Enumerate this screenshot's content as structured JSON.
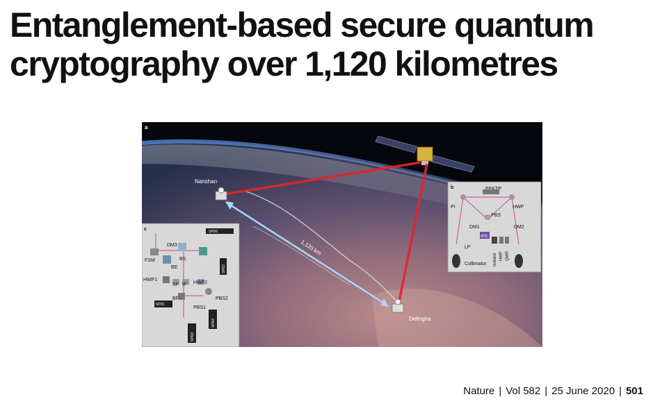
{
  "article": {
    "title_line1": "Entanglement-based secure quantum",
    "title_line2": "cryptography over 1,120 kilometres"
  },
  "figure": {
    "panel_a": {
      "label": "a",
      "ground_station_1": "Nanshan",
      "ground_station_2": "Delingha",
      "distance": "1,120 km"
    },
    "panel_b": {
      "label": "b",
      "components": [
        "PPKTP",
        "PI",
        "HWP",
        "PBS",
        "DM1",
        "DM2",
        "405",
        "LP",
        "Isolator",
        "HWP",
        "QWP",
        "Collimator"
      ]
    },
    "panel_c": {
      "label": "c",
      "components": [
        "DM3",
        "FSM",
        "BS",
        "BE",
        "HWP1",
        "SF",
        "IF",
        "HWP2",
        "PBS2",
        "BF",
        "SPD1",
        "PBS1"
      ],
      "detectors": [
        "SPD6",
        "SPD2",
        "SPD3",
        "SPD4"
      ]
    },
    "colors": {
      "space": "#05070d",
      "uplink_beam": "#e8222a",
      "fiber_link": "#a8d8ff",
      "panel_bg": "#d8d8d8"
    }
  },
  "footer": {
    "journal": "Nature",
    "volume": "Vol 582",
    "date": "25 June 2020",
    "page": "501",
    "separator": "|"
  }
}
